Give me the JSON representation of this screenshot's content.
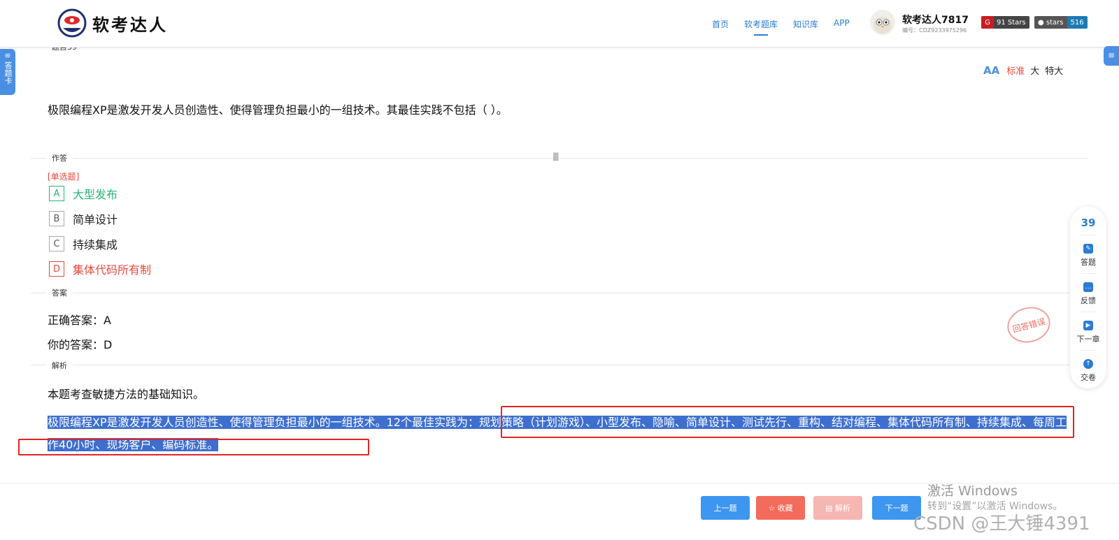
{
  "header": {
    "logo_text": "软考达人",
    "nav": [
      "首页",
      "软考题库",
      "知识库",
      "APP"
    ],
    "active_nav": 1,
    "user_name": "软考达人7817",
    "user_id": "编号：CDZ9233975296",
    "badge_gitee": "91 Stars",
    "badge_github_label": "stars",
    "badge_github_count": "516"
  },
  "side": {
    "answer_card": "答题卡",
    "right_tab_icon": "menu-icon"
  },
  "question": {
    "number_label": "题目39",
    "font_sizes": [
      "标准",
      "大",
      "特大"
    ],
    "font_size_selected": 0,
    "text": "极限编程XP是激发开发人员创造性、使得管理负担最小的一组技术。其最佳实践不包括（ ）。",
    "answer_section_label": "作答",
    "type_label": "[单选题]",
    "options": [
      {
        "key": "A",
        "text": "大型发布",
        "state": "correct"
      },
      {
        "key": "B",
        "text": "简单设计",
        "state": "normal"
      },
      {
        "key": "C",
        "text": "持续集成",
        "state": "normal"
      },
      {
        "key": "D",
        "text": "集体代码所有制",
        "state": "wrong"
      }
    ]
  },
  "answer": {
    "section_label": "答案",
    "correct": "正确答案：A",
    "yours": "你的答案：D",
    "stamp": "回答错误"
  },
  "analysis": {
    "section_label": "解析",
    "line1": "本题考查敏捷方法的基础知识。",
    "line2": "极限编程XP是激发开发人员创造性、使得管理负担最小的一组技术。12个最佳实践为：规划策略（计划游戏）、小型发布、隐喻、简单设计、测试先行、重构、结对编程、集体代码所有制、持续集成、每周工作40小时、现场客户、编码标准。"
  },
  "float_panel": {
    "number": "39",
    "items": [
      {
        "label": "答题",
        "icon": "pencil-icon"
      },
      {
        "label": "反馈",
        "icon": "chat-icon"
      },
      {
        "label": "下一章",
        "icon": "next-icon"
      },
      {
        "label": "交卷",
        "icon": "upload-icon"
      }
    ]
  },
  "footer": {
    "prev": "上一题",
    "fav": "☆ 收藏",
    "analysis": "▤ 解析",
    "next": "下一题"
  },
  "watermark": {
    "activate_title": "激活 Windows",
    "activate_sub": "转到“设置”以激活 Windows。",
    "csdn": "CSDN @王大锤4391"
  },
  "colors": {
    "accent": "#2b7cd3",
    "correct": "#27b37a",
    "wrong": "#e8483b",
    "highlight": "#3e6fcf"
  }
}
